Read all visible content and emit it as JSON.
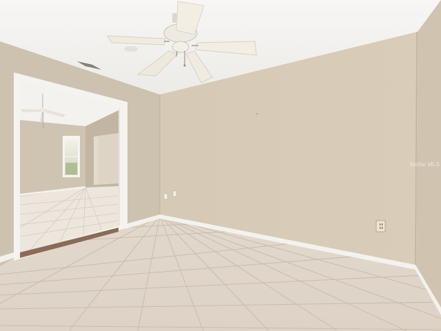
{
  "scene": {
    "type": "empty-room-interior",
    "watermark_text": "Stellar MLS",
    "colors": {
      "ceiling": "#f3f1ee",
      "wall_main": "#d8cbb8",
      "wall_left": "#cfc3b1",
      "wall_right": "#d2c5b2",
      "baseboard": "#f4f2ee",
      "floor_tile": "#e5dcd1",
      "grout": "#c8bdb0",
      "fan_blade": "#f1ece2"
    }
  }
}
